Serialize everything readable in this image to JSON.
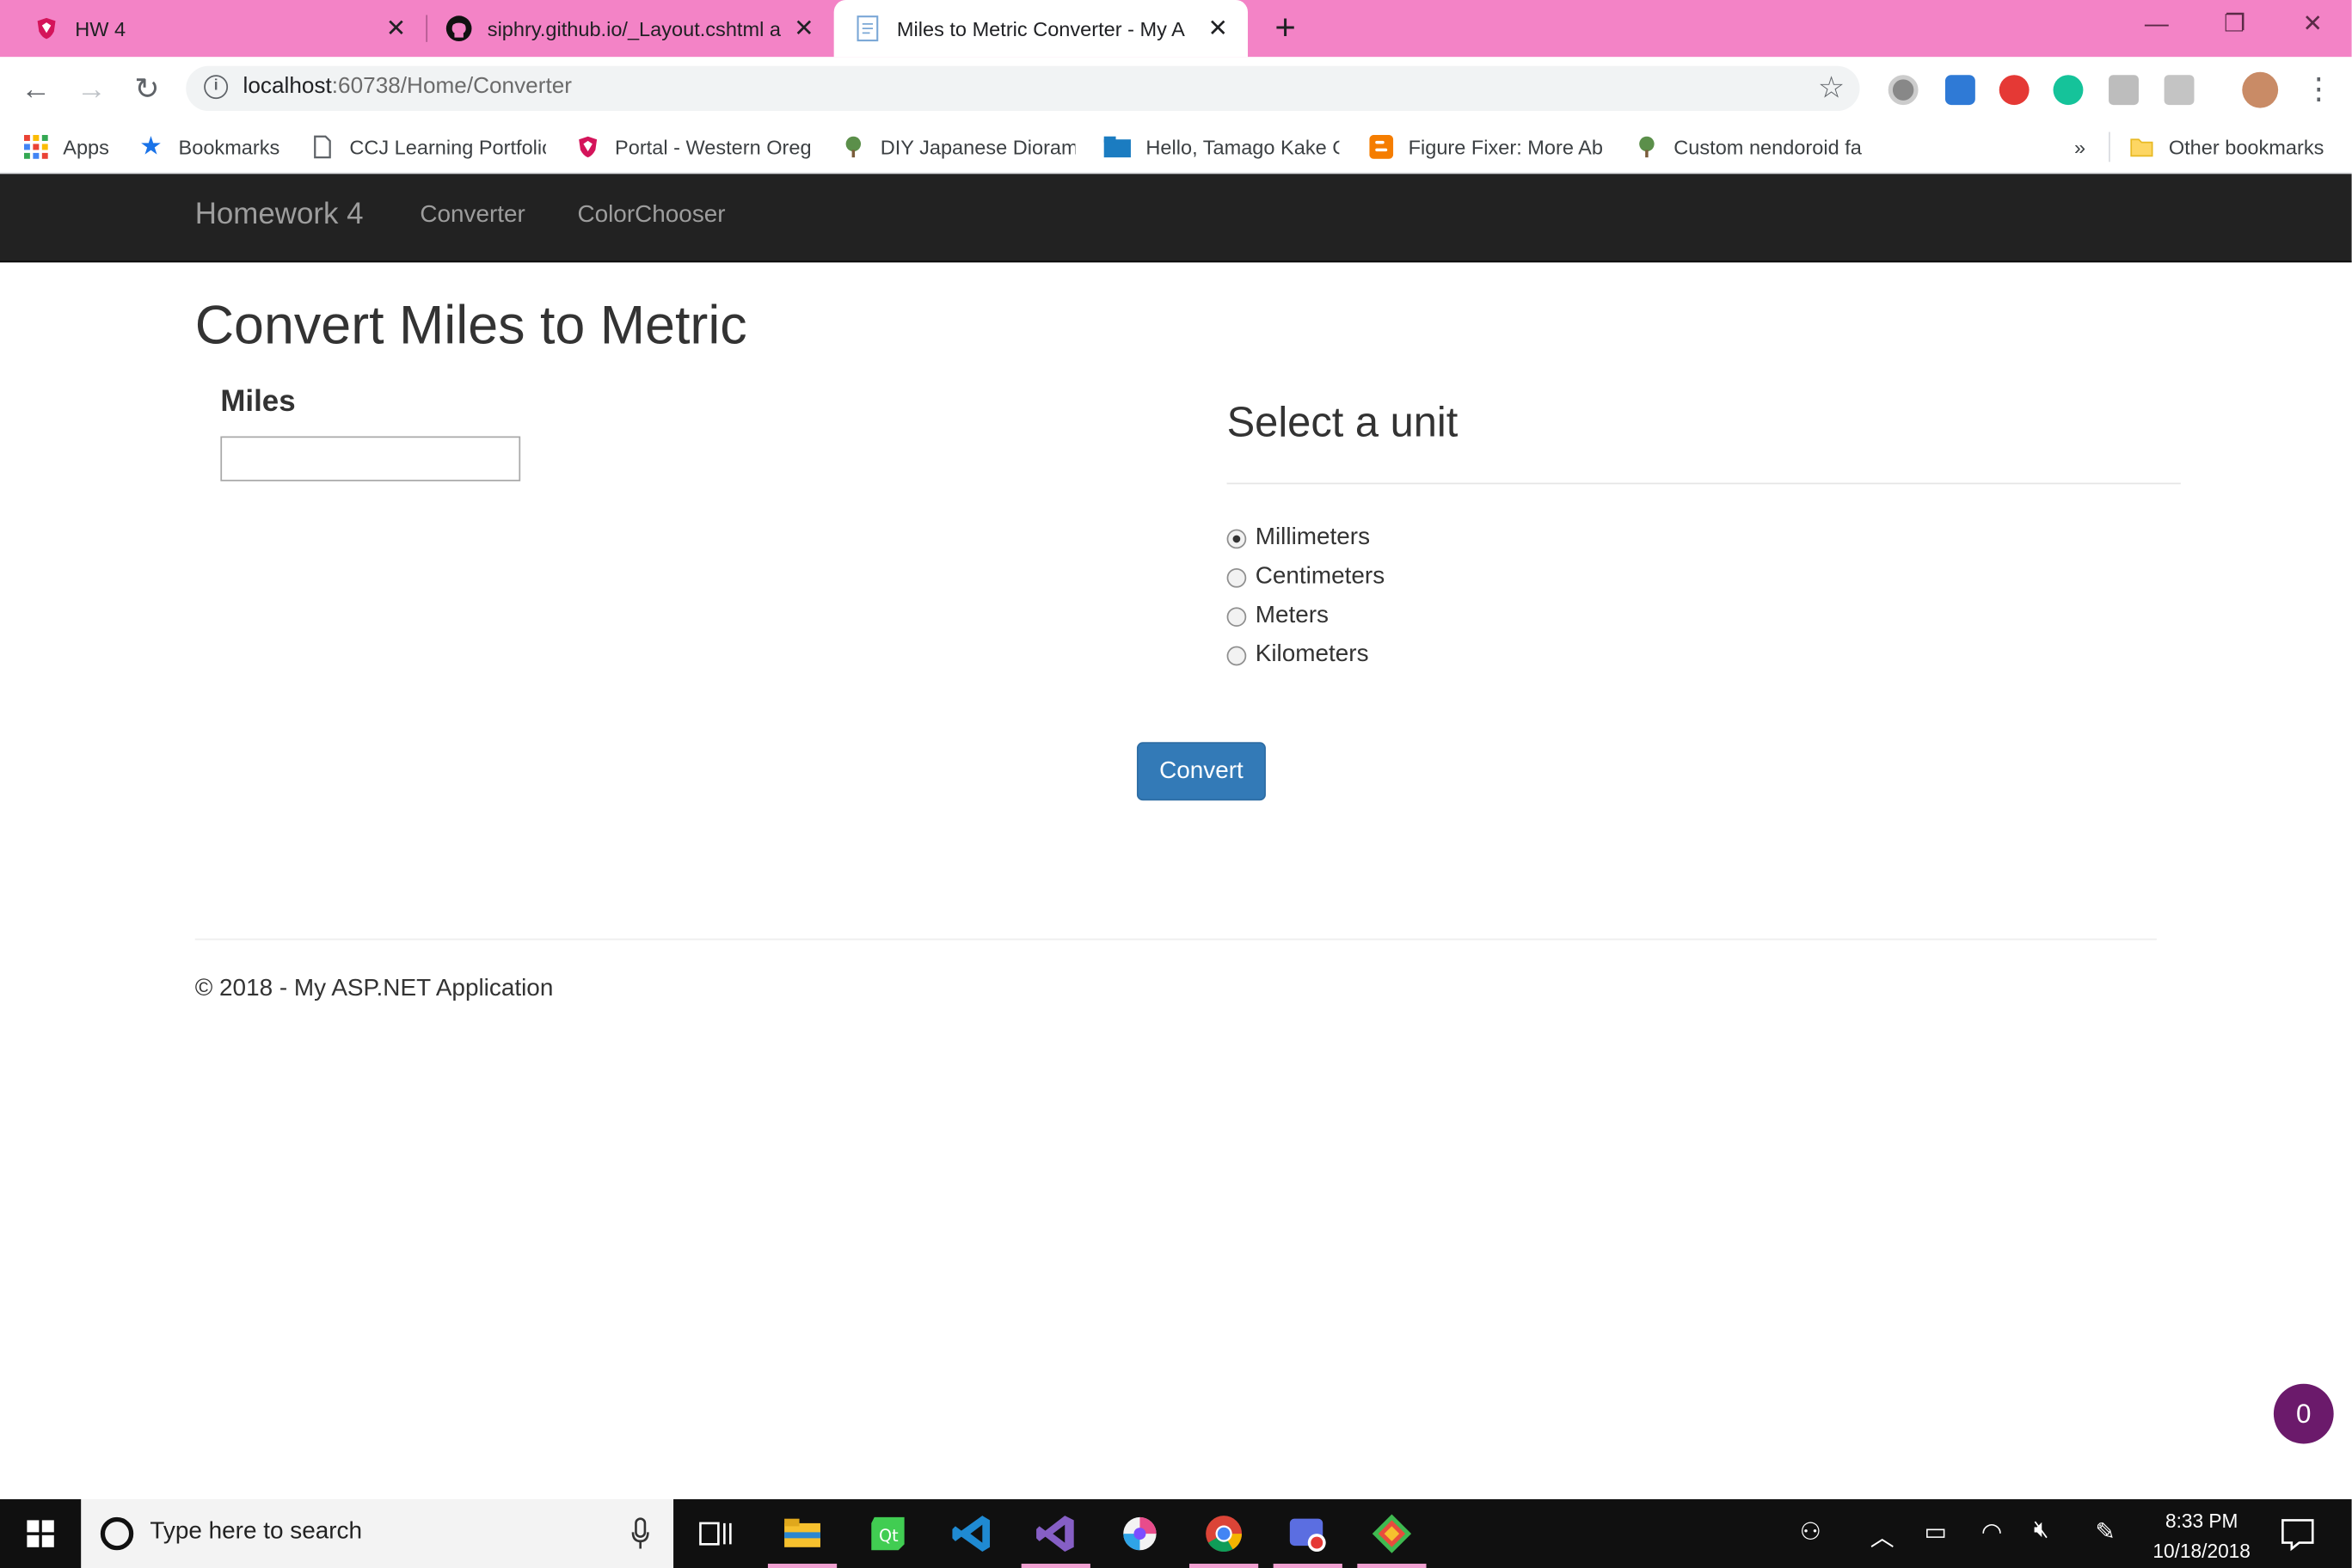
{
  "browser": {
    "tabs": [
      {
        "title": "HW 4",
        "icon": "school-shield-icon"
      },
      {
        "title": "siphry.github.io/_Layout.cshtml a",
        "icon": "github-icon"
      },
      {
        "title": "Miles to Metric Converter - My A",
        "icon": "document-icon"
      }
    ],
    "new_tab_label": "+",
    "address": {
      "host": "localhost",
      "rest": ":60738/Home/Converter"
    },
    "bookmarks": [
      {
        "label": "Apps",
        "icon": "apps-grid-icon"
      },
      {
        "label": "Bookmarks",
        "icon": "star-icon"
      },
      {
        "label": "CCJ Learning Portfolio",
        "icon": "page-icon"
      },
      {
        "label": "Portal - Western Oreg",
        "icon": "school-shield-icon"
      },
      {
        "label": "DIY Japanese Dioram",
        "icon": "tree-icon"
      },
      {
        "label": "Hello, Tamago Kake G",
        "icon": "folder-box-icon"
      },
      {
        "label": "Figure Fixer: More Ab",
        "icon": "blogger-icon"
      },
      {
        "label": "Custom nendoroid fa",
        "icon": "tree-icon"
      }
    ],
    "bookmarks_overflow": "»",
    "other_bookmarks": "Other bookmarks",
    "extension_badge": "0"
  },
  "site": {
    "brand": "Homework 4",
    "nav": [
      "Converter",
      "ColorChooser"
    ],
    "page_title": "Convert Miles to Metric",
    "miles_label": "Miles",
    "miles_value": "",
    "unit_heading": "Select a unit",
    "units": [
      {
        "label": "Millimeters",
        "selected": true
      },
      {
        "label": "Centimeters",
        "selected": false
      },
      {
        "label": "Meters",
        "selected": false
      },
      {
        "label": "Kilometers",
        "selected": false
      }
    ],
    "convert_label": "Convert",
    "footer": "© 2018 - My ASP.NET Application",
    "floating_badge": "0"
  },
  "taskbar": {
    "search_placeholder": "Type here to search",
    "time": "8:33 PM",
    "date": "10/18/2018"
  },
  "colors": {
    "tab_strip": "#f383c6",
    "navbar": "#222222",
    "primary_button": "#337ab7",
    "badge": "#6b1a6b"
  }
}
